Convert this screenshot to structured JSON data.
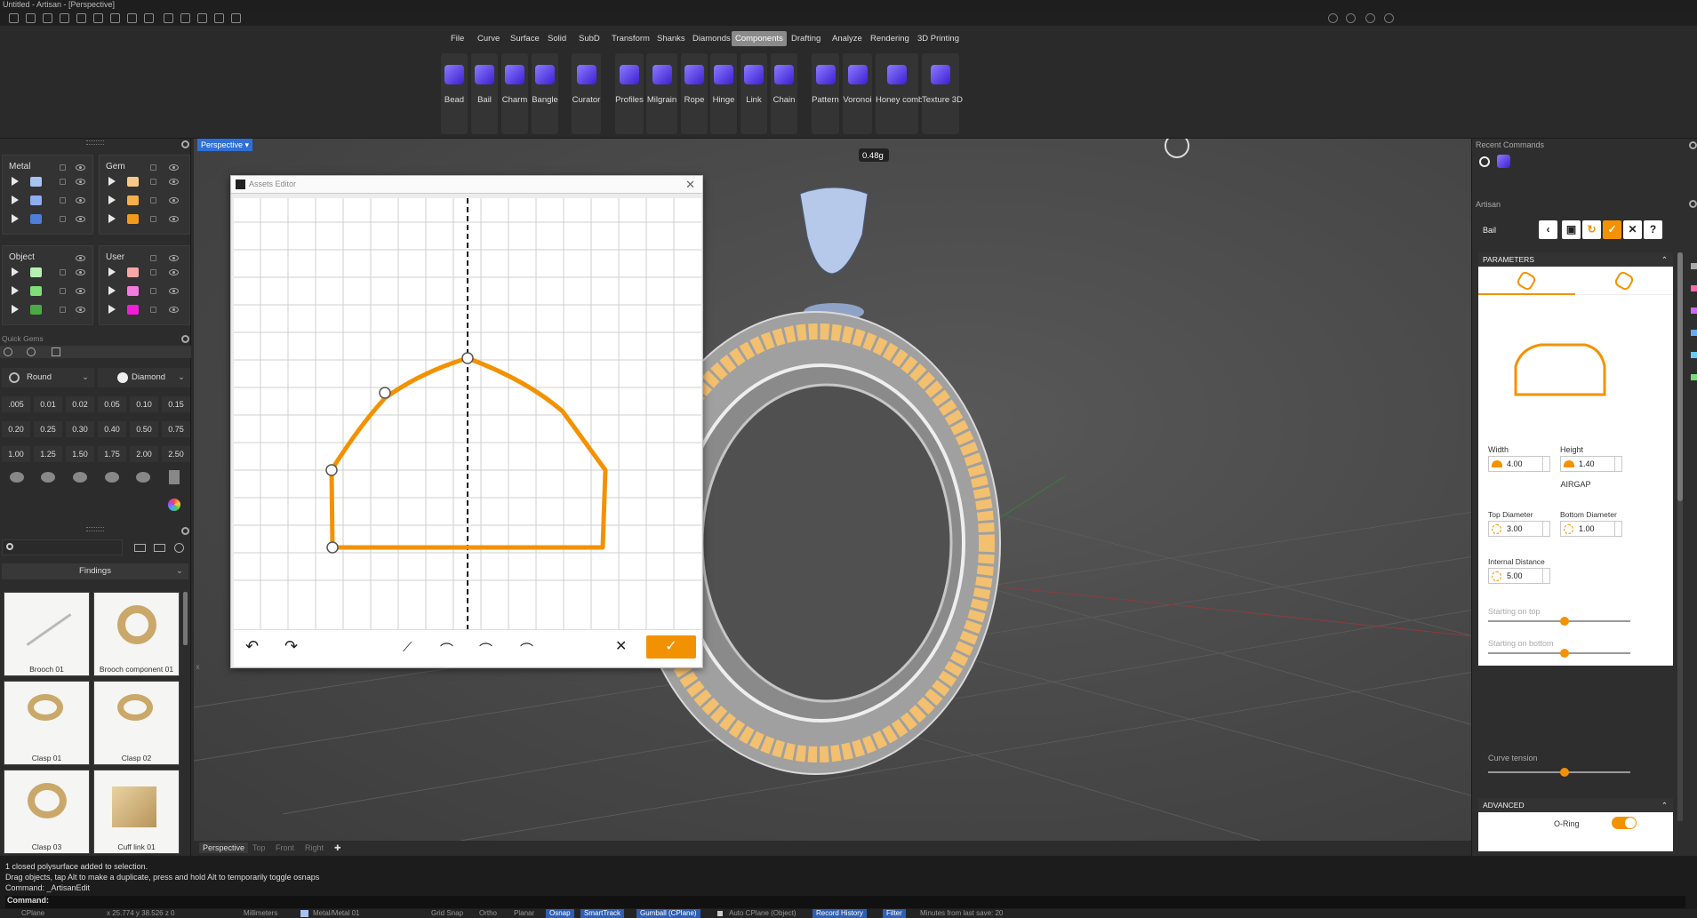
{
  "window": {
    "title": "Untitled - Artisan - [Perspective]"
  },
  "menu": {
    "tabs": [
      "File",
      "Curve",
      "Surface",
      "Solid",
      "SubD",
      "Transform",
      "Shanks",
      "Diamonds",
      "Components",
      "Drafting",
      "Analyze",
      "Rendering",
      "3D Printing"
    ],
    "active": "Components"
  },
  "ribbon": {
    "buttons": [
      "Bead",
      "Bail",
      "Charm",
      "Bangle",
      "Curator",
      "Profiles",
      "Milgrain",
      "Rope",
      "Hinge",
      "Link",
      "Chain",
      "Pattern",
      "Voronoi",
      "Honey comb",
      "Texture 3D"
    ]
  },
  "layers": {
    "metal": {
      "title": "Metal",
      "colors": [
        "#a7c3f3",
        "#8faef0",
        "#4f7ed8"
      ]
    },
    "gem": {
      "title": "Gem",
      "colors": [
        "#f6c98a",
        "#f4b04c",
        "#f19b1c"
      ]
    },
    "object": {
      "title": "Object",
      "colors": [
        "#b7f0b3",
        "#7fe07a",
        "#4caa44"
      ]
    },
    "user": {
      "title": "User",
      "colors": [
        "#f6a7a7",
        "#f47adf",
        "#f01ed6"
      ]
    }
  },
  "quick_gems": {
    "title": "Quick Gems",
    "shape": "Round",
    "type": "Diamond",
    "sizes": [
      ".005",
      "0.01",
      "0.02",
      "0.05",
      "0.10",
      "0.15",
      "0.20",
      "0.25",
      "0.30",
      "0.40",
      "0.50",
      "0.75",
      "1.00",
      "1.25",
      "1.50",
      "1.75",
      "2.00",
      "2.50"
    ]
  },
  "findings": {
    "title": "Findings",
    "items": [
      "Brooch 01",
      "Brooch component 01",
      "Clasp 01",
      "Clasp 02",
      "Clasp 03",
      "Cuff link 01"
    ]
  },
  "viewport": {
    "name": "Perspective",
    "weight_label": "0.48g",
    "tabs": [
      "Perspective",
      "Top",
      "Front",
      "Right"
    ]
  },
  "assets_editor": {
    "title": "Assets Editor"
  },
  "right_panel": {
    "recent_title": "Recent Commands",
    "artisan_title": "Artisan",
    "command_name": "Bail",
    "parameters_title": "PARAMETERS",
    "width_label": "Width",
    "width_value": "4.00",
    "height_label": "Height",
    "height_value": "1.40",
    "airgap_label": "AIRGAP",
    "top_diameter_label": "Top Diameter",
    "top_diameter_value": "3.00",
    "bottom_diameter_label": "Bottom Diameter",
    "bottom_diameter_value": "1.00",
    "internal_distance_label": "Internal Distance",
    "internal_distance_value": "5.00",
    "starting_top_label": "Starting on top",
    "starting_top_value": 0.54,
    "starting_bottom_label": "Starting on bottom",
    "starting_bottom_value": 0.54,
    "curve_tension_label": "Curve tension",
    "curve_tension_value": 0.54,
    "advanced_title": "ADVANCED",
    "oring_label": "O-Ring"
  },
  "command_history": [
    "1 closed polysurface added to selection.",
    "Drag objects, tap Alt to make a duplicate, press and hold Alt to temporarily toggle osnaps",
    "Command: _ArtisanEdit"
  ],
  "command_prompt": "Command:",
  "status": {
    "cplane": "CPlane",
    "coords": "x 25.774  y 38.526  z 0",
    "units": "Millimeters",
    "layer": "Metal/Metal 01",
    "toggles": [
      "Grid Snap",
      "Ortho",
      "Planar",
      "Osnap",
      "SmartTrack",
      "Gumball (CPlane)",
      "Auto CPlane (Object)",
      "Record History",
      "Filter"
    ],
    "last_save": "Minutes from last save: 20"
  }
}
